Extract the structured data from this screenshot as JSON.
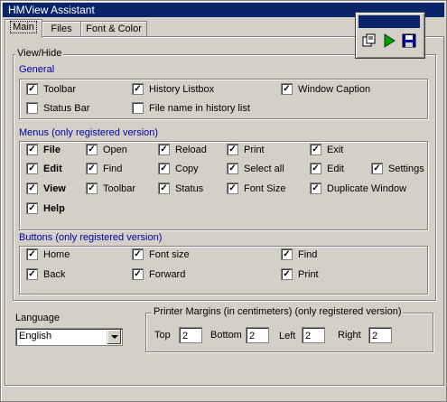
{
  "window": {
    "title": "HMView Assistant"
  },
  "tabs": [
    {
      "label": "Main"
    },
    {
      "label": "Files"
    },
    {
      "label": "Font & Color"
    }
  ],
  "toolbar_palette": {
    "icons": [
      "copy-icon",
      "play-icon",
      "save-icon"
    ],
    "colors": {
      "play": "#00a000",
      "save": "#0000a0"
    }
  },
  "view_hide": {
    "label": "View/Hide",
    "general": {
      "label": "General",
      "items": [
        {
          "label": "Toolbar",
          "checked": true
        },
        {
          "label": "History Listbox",
          "checked": true
        },
        {
          "label": "Window Caption",
          "checked": true
        },
        {
          "label": "Status Bar",
          "checked": false
        },
        {
          "label": "File name in history list",
          "checked": false
        }
      ]
    },
    "menus": {
      "label": "Menus (only registered version)",
      "items": [
        {
          "label": "File",
          "checked": true
        },
        {
          "label": "Open",
          "checked": true
        },
        {
          "label": "Reload",
          "checked": true
        },
        {
          "label": "Print",
          "checked": true
        },
        {
          "label": "Exit",
          "checked": true
        },
        {
          "label": "Edit",
          "checked": true
        },
        {
          "label": "Find",
          "checked": true
        },
        {
          "label": "Copy",
          "checked": true
        },
        {
          "label": "Select all",
          "checked": true
        },
        {
          "label": "Edit",
          "checked": true
        },
        {
          "label": "Settings",
          "checked": true
        },
        {
          "label": "View",
          "checked": true
        },
        {
          "label": "Toolbar",
          "checked": true
        },
        {
          "label": "Status",
          "checked": true
        },
        {
          "label": "Font Size",
          "checked": true
        },
        {
          "label": "Duplicate Window",
          "checked": true
        },
        {
          "label": "Help",
          "checked": true
        }
      ]
    },
    "buttons": {
      "label": "Buttons (only registered version)",
      "items": [
        {
          "label": "Home",
          "checked": true
        },
        {
          "label": "Font size",
          "checked": true
        },
        {
          "label": "Find",
          "checked": true
        },
        {
          "label": "Back",
          "checked": true
        },
        {
          "label": "Forward",
          "checked": true
        },
        {
          "label": "Print",
          "checked": true
        }
      ]
    }
  },
  "language": {
    "label": "Language",
    "value": "English"
  },
  "printer_margins": {
    "label": "Printer Margins (in centimeters) (only registered version)",
    "top": {
      "label": "Top",
      "value": "2"
    },
    "bottom": {
      "label": "Bottom",
      "value": "2"
    },
    "left": {
      "label": "Left",
      "value": "2"
    },
    "right": {
      "label": "Right",
      "value": "2"
    }
  }
}
